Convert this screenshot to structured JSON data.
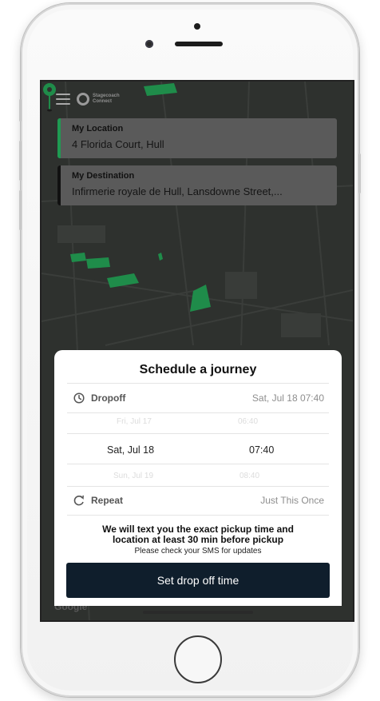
{
  "app": {
    "brand_line1": "Stagecoach",
    "brand_line2": "Connect"
  },
  "locations": {
    "origin_title": "My Location",
    "origin_value": "4 Florida Court, Hull",
    "destination_title": "My Destination",
    "destination_value": "Infirmerie royale de Hull, Lansdowne Street,..."
  },
  "map": {
    "attribution": "Google"
  },
  "sheet": {
    "title": "Schedule a journey",
    "dropoff_label": "Dropoff",
    "dropoff_value": "Sat, Jul 18 07:40",
    "picker": {
      "prev_date": "Fri, Jul 17",
      "prev_time": "06:40",
      "selected_date": "Sat, Jul 18",
      "selected_time": "07:40",
      "next_date": "Sun, Jul 19",
      "next_time": "08:40"
    },
    "repeat_label": "Repeat",
    "repeat_value": "Just This Once",
    "notice_line1": "We will text you the exact pickup time and",
    "notice_line2": "location at least 30 min before pickup",
    "notice_sub": "Please check your SMS for updates",
    "cta_label": "Set drop off time"
  },
  "colors": {
    "origin_accent": "#1f9a52",
    "destination_accent": "#111111",
    "map_green": "#1f8c4a",
    "cta_background": "#0f1e2c"
  }
}
